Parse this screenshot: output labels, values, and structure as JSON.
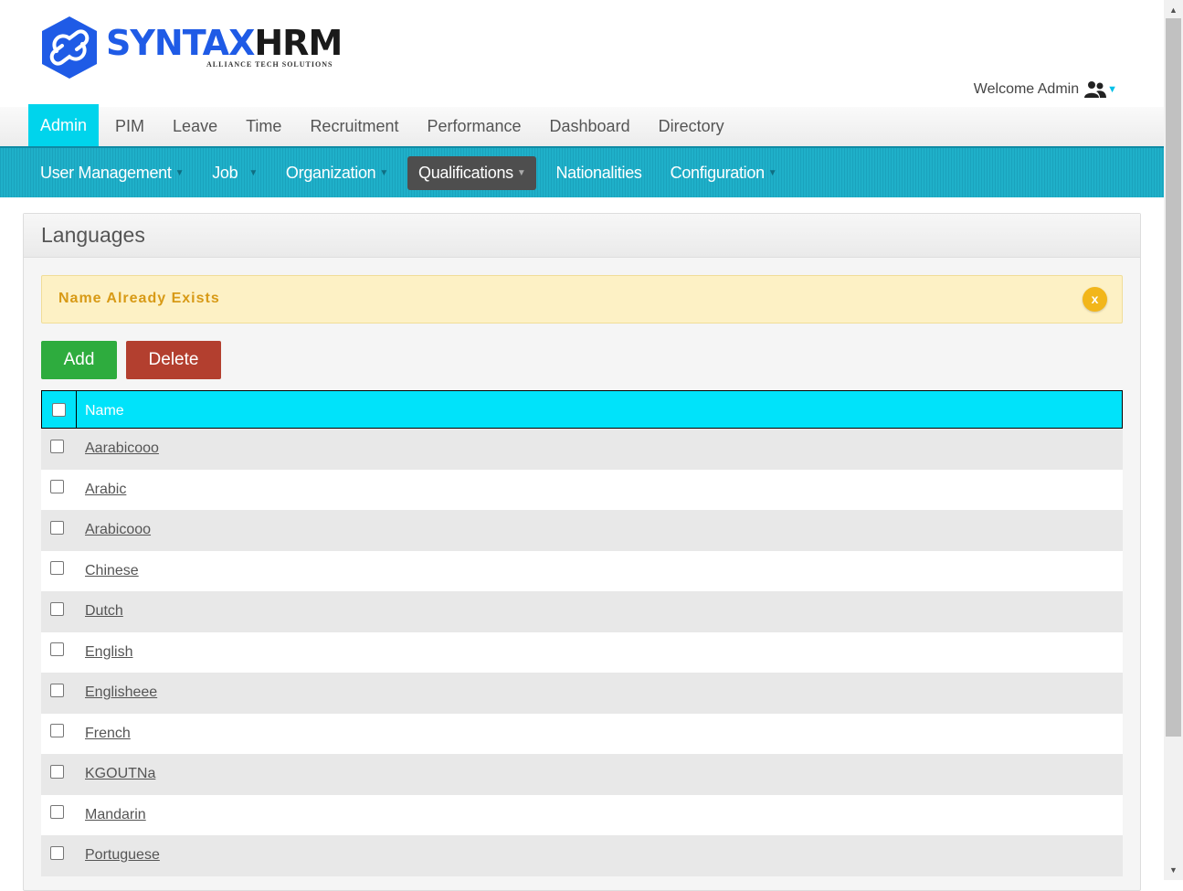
{
  "logo": {
    "brand_part1": "SYNTAX",
    "brand_part2": "HRM",
    "tagline": "ALLIANCE TECH SOLUTIONS"
  },
  "header": {
    "welcome_text": "Welcome Admin",
    "user_icon": "users-icon",
    "dropdown_icon": "caret-down-icon"
  },
  "main_nav": {
    "items": [
      {
        "label": "Admin",
        "active": true
      },
      {
        "label": "PIM"
      },
      {
        "label": "Leave"
      },
      {
        "label": "Time"
      },
      {
        "label": "Recruitment"
      },
      {
        "label": "Performance"
      },
      {
        "label": "Dashboard"
      },
      {
        "label": "Directory"
      }
    ]
  },
  "sub_nav": {
    "items": [
      {
        "label": "User Management",
        "dropdown": true
      },
      {
        "label": "Job",
        "dropdown": true
      },
      {
        "label": "Organization",
        "dropdown": true
      },
      {
        "label": "Qualifications",
        "dropdown": true,
        "active": true
      },
      {
        "label": "Nationalities"
      },
      {
        "label": "Configuration",
        "dropdown": true
      }
    ]
  },
  "panel": {
    "title": "Languages",
    "alert": {
      "message": "Name Already Exists",
      "close_label": "x"
    },
    "buttons": {
      "add_label": "Add",
      "delete_label": "Delete"
    },
    "table": {
      "header_name": "Name",
      "rows": [
        "Aarabicooo",
        "Arabic",
        "Arabicooo",
        "Chinese",
        "Dutch",
        "English",
        "Englisheee",
        "French",
        "KGOUTNa",
        "Mandarin",
        "Portuguese"
      ]
    }
  },
  "colors": {
    "accent": "#00d4ec",
    "subnav": "#1fb0c9",
    "add": "#2eac3e",
    "delete": "#b33f2f",
    "alert_text": "#d89a16"
  }
}
